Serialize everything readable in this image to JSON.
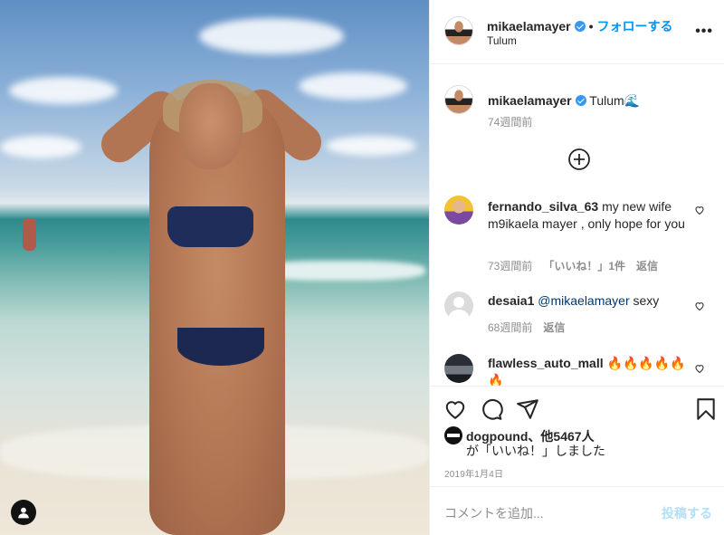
{
  "header": {
    "username": "mikaelamayer",
    "separator": "•",
    "follow_label": "フォローする",
    "location": "Tulum",
    "more_icon": "•••"
  },
  "caption": {
    "username": "mikaelamayer",
    "text": "Tulum🌊",
    "time": "74週間前"
  },
  "comments": [
    {
      "username": "fernando_silva_63",
      "text": "my new wife m9ikaela mayer , only hope for you",
      "time": "73週間前",
      "likes": "「いいね！」1件",
      "reply": "返信"
    },
    {
      "username": "desaia1",
      "mention": "@mikaelamayer",
      "text": "sexy",
      "time": "68週間前",
      "reply": "返信"
    },
    {
      "username": "flawless_auto_mall",
      "text": "🔥🔥🔥🔥🔥🔥"
    }
  ],
  "likes": {
    "username": "dogpound",
    "others": "、他5467人",
    "suffix": "が「いいね！」しました"
  },
  "date": "2019年1月4日",
  "add_comment": {
    "placeholder": "コメントを追加...",
    "post_label": "投稿する"
  },
  "colors": {
    "accent": "#0095f6",
    "verified": "#3897f0",
    "muted": "#8e8e8e",
    "post_disabled": "#b2dffc"
  },
  "icons": [
    "user-tag-icon",
    "more-icon",
    "verified-icon",
    "plus-circle-icon",
    "heart-icon",
    "comment-icon",
    "share-icon",
    "bookmark-icon"
  ]
}
